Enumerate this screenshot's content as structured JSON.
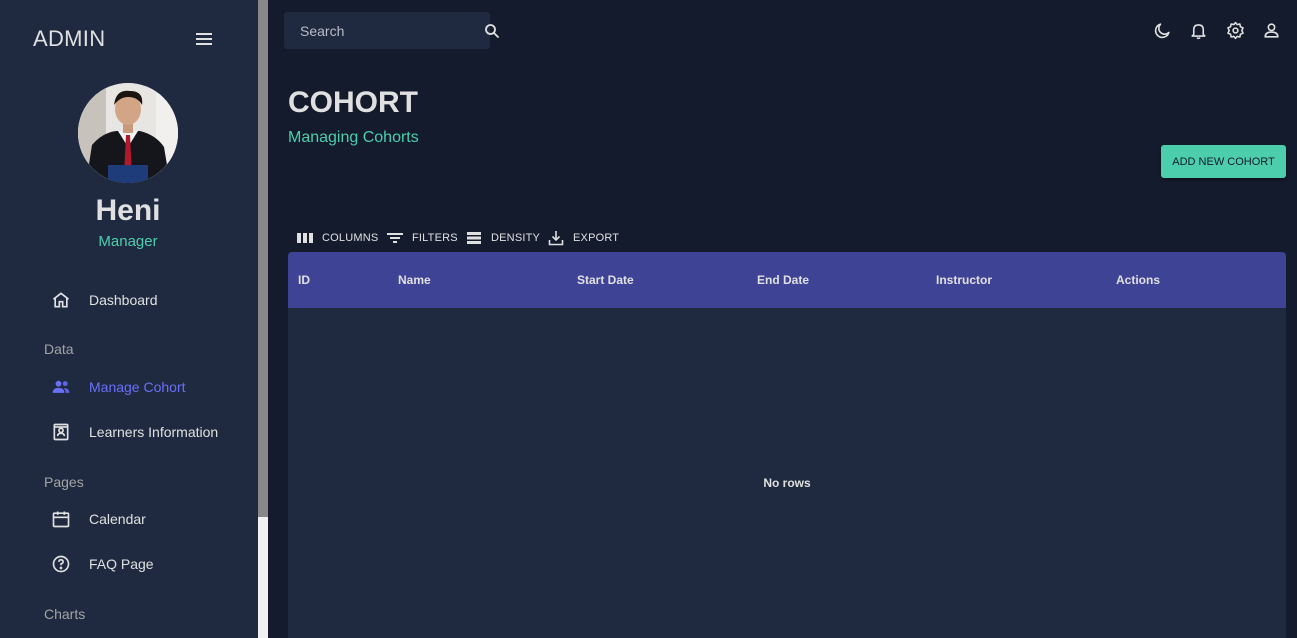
{
  "sidebar": {
    "brand": "ADMIN",
    "user": {
      "name": "Heni",
      "role": "Manager"
    },
    "items": [
      {
        "label": "Dashboard",
        "icon": "home-icon"
      },
      {
        "label": "Manage Cohort",
        "icon": "people-icon",
        "active": true
      },
      {
        "label": "Learners Information",
        "icon": "contact-card-icon"
      },
      {
        "label": "Calendar",
        "icon": "calendar-icon"
      },
      {
        "label": "FAQ Page",
        "icon": "help-circle-icon"
      }
    ],
    "sections": [
      "Data",
      "Pages",
      "Charts"
    ]
  },
  "topbar": {
    "search_placeholder": "Search",
    "icons": [
      "dark-mode-icon",
      "notifications-icon",
      "settings-icon",
      "profile-icon"
    ]
  },
  "header": {
    "title": "COHORT",
    "subtitle": "Managing Cohorts",
    "add_button": "ADD NEW COHORT"
  },
  "toolbar": {
    "columns": "COLUMNS",
    "filters": "FILTERS",
    "density": "DENSITY",
    "export": "EXPORT"
  },
  "grid": {
    "columns": [
      "ID",
      "Name",
      "Start Date",
      "End Date",
      "Instructor",
      "Actions"
    ],
    "empty_text": "No rows"
  },
  "colors": {
    "background": "#141b2d",
    "panel": "#1f2a40",
    "accent_green": "#4cceac",
    "accent_blue": "#6870fa",
    "grid_header": "#3e4396"
  }
}
